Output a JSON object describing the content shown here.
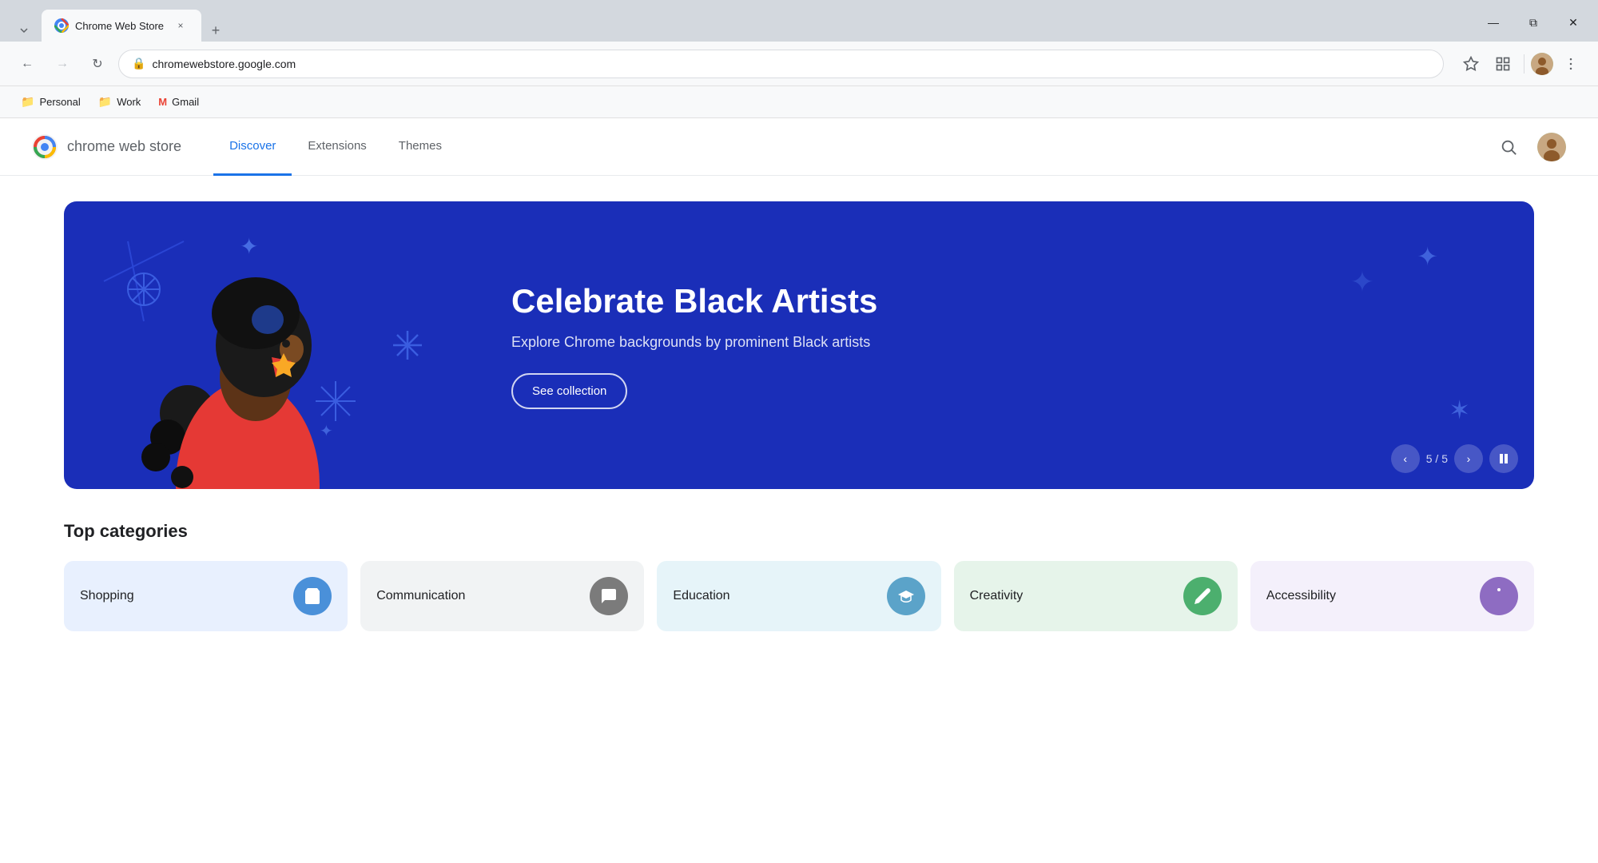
{
  "browser": {
    "tab": {
      "favicon_label": "rainbow",
      "title": "Chrome Web Store",
      "close_label": "×"
    },
    "new_tab_label": "+",
    "window_controls": {
      "minimize": "—",
      "maximize": "⧉",
      "close": "✕"
    },
    "nav": {
      "back_label": "←",
      "forward_label": "→",
      "reload_label": "↻",
      "url": "chromewebstore.google.com",
      "bookmark_label": "☆",
      "extensions_label": "⧈",
      "split_label": "⊟",
      "more_label": "⋮"
    },
    "bookmarks": [
      {
        "label": "Personal",
        "icon": "📁"
      },
      {
        "label": "Work",
        "icon": "📁"
      },
      {
        "label": "Gmail",
        "icon": "M"
      }
    ]
  },
  "cws": {
    "logo_alt": "Chrome Web Store logo",
    "logo_text": "chrome web store",
    "nav_items": [
      {
        "label": "Discover",
        "active": true
      },
      {
        "label": "Extensions",
        "active": false
      },
      {
        "label": "Themes",
        "active": false
      }
    ],
    "search_label": "🔍",
    "hero": {
      "title": "Celebrate Black Artists",
      "subtitle": "Explore Chrome backgrounds by prominent Black artists",
      "cta_label": "See collection",
      "slide_current": 5,
      "slide_total": 5,
      "slide_label": "5 / 5",
      "prev_label": "‹",
      "next_label": "›",
      "pause_label": "⏸"
    },
    "categories_title": "Top categories",
    "categories": [
      {
        "label": "Shopping",
        "theme": "shopping",
        "icon": "🛍"
      },
      {
        "label": "Communication",
        "theme": "communication",
        "icon": "💬"
      },
      {
        "label": "Education",
        "theme": "education",
        "icon": "🎓"
      },
      {
        "label": "Creativity",
        "theme": "creativity",
        "icon": "✏️"
      },
      {
        "label": "Accessibility",
        "theme": "accessibility",
        "icon": "♿"
      }
    ]
  }
}
